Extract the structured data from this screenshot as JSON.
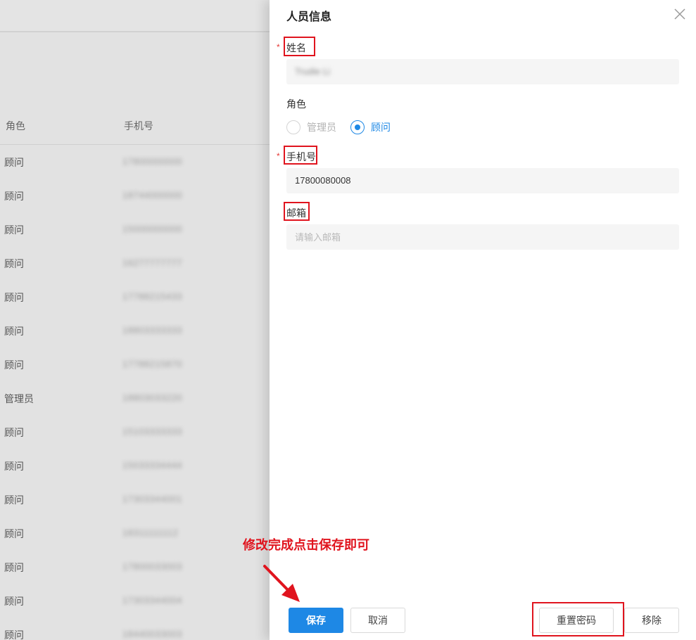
{
  "background": {
    "columns": {
      "role": "角色",
      "phone": "手机号"
    },
    "rows": [
      {
        "role": "顾问",
        "phone": "17800000000"
      },
      {
        "role": "顾问",
        "phone": "18744000000"
      },
      {
        "role": "顾问",
        "phone": "15000000000"
      },
      {
        "role": "顾问",
        "phone": "16277777777"
      },
      {
        "role": "顾问",
        "phone": "17788215433"
      },
      {
        "role": "顾问",
        "phone": "18803333333"
      },
      {
        "role": "顾问",
        "phone": "17788215870"
      },
      {
        "role": "管理员",
        "phone": "18803033220"
      },
      {
        "role": "顾问",
        "phone": "15103333333"
      },
      {
        "role": "顾问",
        "phone": "15033334444"
      },
      {
        "role": "顾问",
        "phone": "17303344001"
      },
      {
        "role": "顾问",
        "phone": "18311111112"
      },
      {
        "role": "顾问",
        "phone": "17800033003"
      },
      {
        "role": "顾问",
        "phone": "17303344004"
      },
      {
        "role": "顾问",
        "phone": "18440033003"
      }
    ]
  },
  "drawer": {
    "title": "人员信息",
    "name": {
      "label": "姓名",
      "required_mark": "*",
      "value": "Trudie Li"
    },
    "role": {
      "label": "角色",
      "options": [
        {
          "label": "管理员",
          "checked": false
        },
        {
          "label": "顾问",
          "checked": true
        }
      ]
    },
    "phone": {
      "label": "手机号",
      "required_mark": "*",
      "value": "17800080008"
    },
    "email": {
      "label": "邮箱",
      "value": "",
      "placeholder": "请输入邮箱"
    },
    "buttons": {
      "save": "保存",
      "cancel": "取消",
      "reset_password": "重置密码",
      "remove": "移除"
    }
  },
  "annotation": {
    "text": "修改完成点击保存即可"
  },
  "colors": {
    "accent": "#1e88e5",
    "highlight": "#e0141e"
  }
}
